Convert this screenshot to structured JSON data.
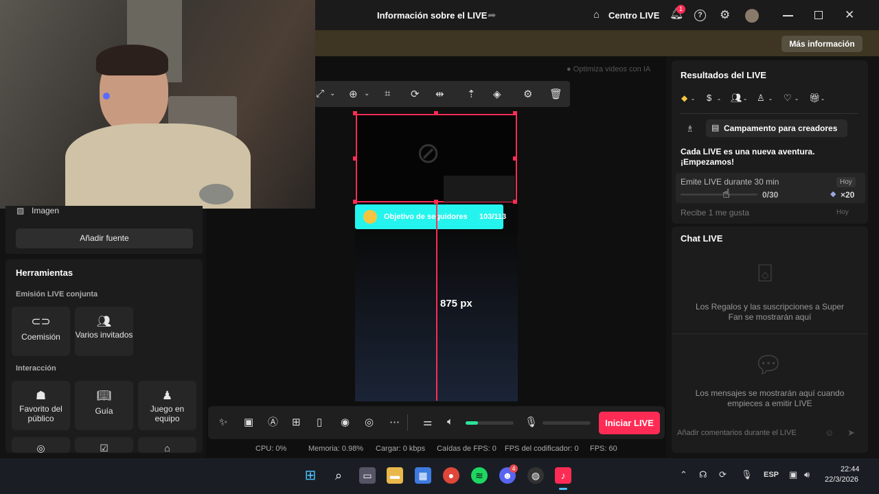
{
  "topbar": {
    "title": "Información sobre el LIVE",
    "centro_live": "Centro LIVE",
    "notif_count": "1"
  },
  "notice": {
    "more_info": "Más información"
  },
  "preview_hint": "Optimiza videos con IA",
  "left": {
    "source_label": "Imagen",
    "add_source": "Añadir fuente",
    "tools_title": "Herramientas",
    "section_cohost": "Emisión LIVE conjunta",
    "section_interaction": "Interacción",
    "tools_cohost": [
      {
        "label": "Coemisión",
        "icon": "link-icon"
      },
      {
        "label": "Varios invitados",
        "icon": "users-icon"
      }
    ],
    "tools_interaction": [
      {
        "label": "Favorito del público",
        "icon": "crowd-icon"
      },
      {
        "label": "Guía",
        "icon": "book-icon"
      },
      {
        "label": "Juego en equipo",
        "icon": "team-icon"
      }
    ]
  },
  "canvas": {
    "goal_label": "Objetivo de seguidores",
    "goal_count": "103/113",
    "measure": "875 px"
  },
  "controls": {
    "start": "Iniciar LIVE"
  },
  "status": {
    "cpu": "CPU:  0%",
    "memory": "Memoria:  0.98%",
    "load": "Cargar:  0 kbps",
    "fps_drops": "Caídas de FPS:  0",
    "encoder_fps": "FPS del codificador:  0",
    "fps": "FPS:  60"
  },
  "results": {
    "title": "Resultados del LIVE",
    "stats": [
      "-",
      "-",
      "-",
      "-",
      "-",
      "-"
    ],
    "camp": "Campamento para creadores",
    "tagline_1": "Cada LIVE es una nueva aventura.",
    "tagline_2": "¡Empezamos!",
    "task1_label": "Emite LIVE durante 30 min",
    "task1_badge": "Hoy",
    "task1_progress": "0/30",
    "task1_progress_fraction": 0,
    "task1_reward": "×20",
    "task2_label": "Recibe 1 me gusta",
    "task2_badge": "Hoy"
  },
  "chat": {
    "title": "Chat LIVE",
    "gifts_empty": "Los Regalos y las suscripciones a Super Fan se mostrarán aquí",
    "messages_empty": "Los mensajes se mostrarán aquí cuando empieces a emitir LIVE",
    "input_placeholder": "Añadir comentarios durante el LIVE"
  },
  "taskbar": {
    "lang": "ESP",
    "time": "22:44",
    "date": "22/3/2026",
    "discord_badge": "4"
  },
  "colors": {
    "accent": "#fe2c55",
    "cyan": "#25f4ee",
    "volume": "#2de39a"
  }
}
